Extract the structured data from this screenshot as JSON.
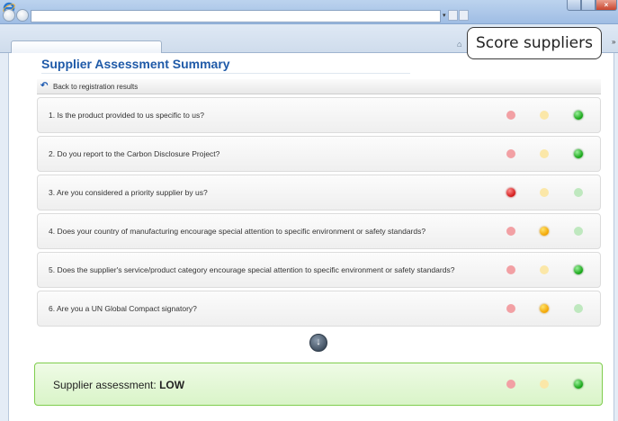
{
  "callout": {
    "label": "Score suppliers"
  },
  "page": {
    "title": "Supplier Assessment Summary"
  },
  "back_link": {
    "label": "Back to registration results"
  },
  "questions": [
    {
      "text": "1. Is the product provided to us specific to us?",
      "rating": "green"
    },
    {
      "text": "2. Do you report to the Carbon Disclosure Project?",
      "rating": "green"
    },
    {
      "text": "3. Are you considered a priority supplier by us?",
      "rating": "red"
    },
    {
      "text": "4. Does your country of manufacturing encourage special attention to specific environment or safety standards?",
      "rating": "yellow"
    },
    {
      "text": "5. Does the supplier's service/product category encourage special attention to specific environment or safety standards?",
      "rating": "green"
    },
    {
      "text": "6. Are you a UN Global Compact signatory?",
      "rating": "yellow"
    }
  ],
  "summary": {
    "label": "Supplier assessment:",
    "value": "LOW",
    "rating": "green"
  },
  "colors": {
    "title": "#1f5aa8",
    "summary_border": "#7fcd4d",
    "red": "#d11818",
    "yellow": "#f2a400",
    "green": "#12a312"
  }
}
